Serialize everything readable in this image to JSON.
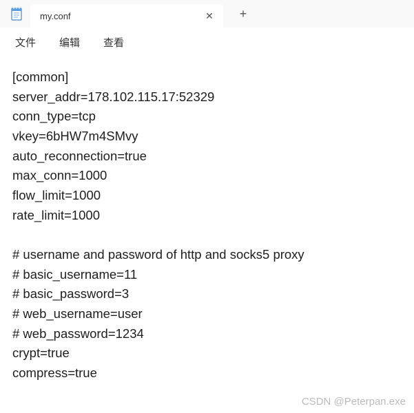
{
  "titlebar": {
    "tab_title": "my.conf",
    "close_glyph": "✕",
    "new_tab_glyph": "+"
  },
  "menubar": {
    "items": [
      "文件",
      "编辑",
      "查看"
    ]
  },
  "editor": {
    "content": "[common]\nserver_addr=178.102.115.17:52329\nconn_type=tcp\nvkey=6bHW7m4SMvy\nauto_reconnection=true\nmax_conn=1000\nflow_limit=1000\nrate_limit=1000\n\n# username and password of http and socks5 proxy\n# basic_username=11\n# basic_password=3\n# web_username=user\n# web_password=1234\ncrypt=true\ncompress=true"
  },
  "watermark": "CSDN @Peterpan.exe"
}
